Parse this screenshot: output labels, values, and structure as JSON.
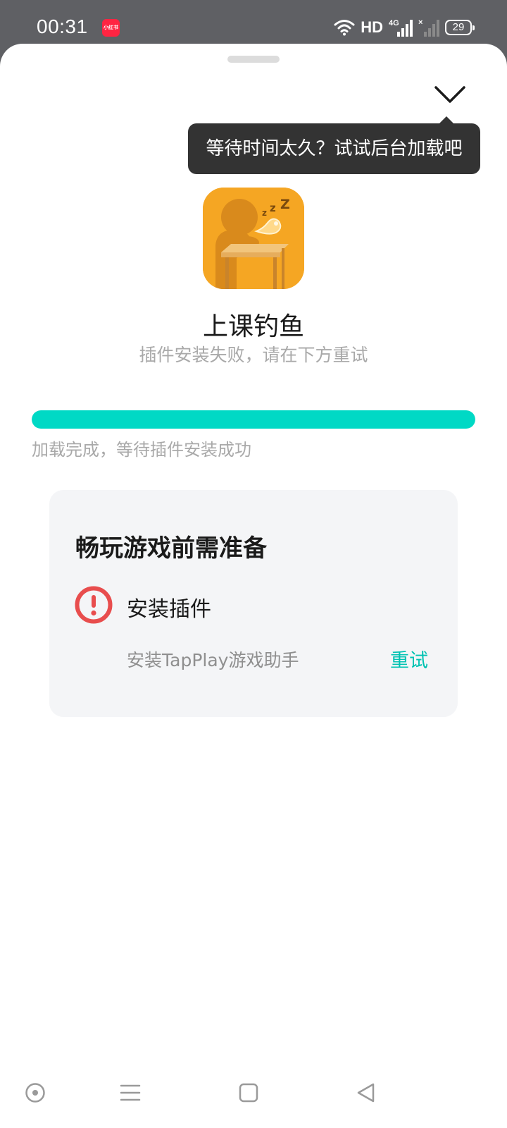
{
  "status_bar": {
    "time": "00:31",
    "app_badge": "小红书",
    "network": "HD",
    "cell": "4G",
    "battery": "29"
  },
  "tooltip": {
    "text": "等待时间太久？试试后台加载吧"
  },
  "game": {
    "title": "上课钓鱼",
    "subtitle": "插件安装失败，请在下方重试",
    "icon": "sleeping-student-icon"
  },
  "progress": {
    "fraction": 1.0,
    "status_text": "加载完成，等待插件安装成功",
    "color": "#00d9c5"
  },
  "prep_card": {
    "title": "畅玩游戏前需准备",
    "step_label": "安装插件",
    "step_desc": "安装TapPlay游戏助手",
    "retry_label": "重试",
    "error_color": "#e84d4d",
    "accent_color": "#00c2b2"
  },
  "nav_bar": {
    "icons": [
      "assistant-icon",
      "menu-icon",
      "home-icon",
      "back-icon"
    ]
  }
}
